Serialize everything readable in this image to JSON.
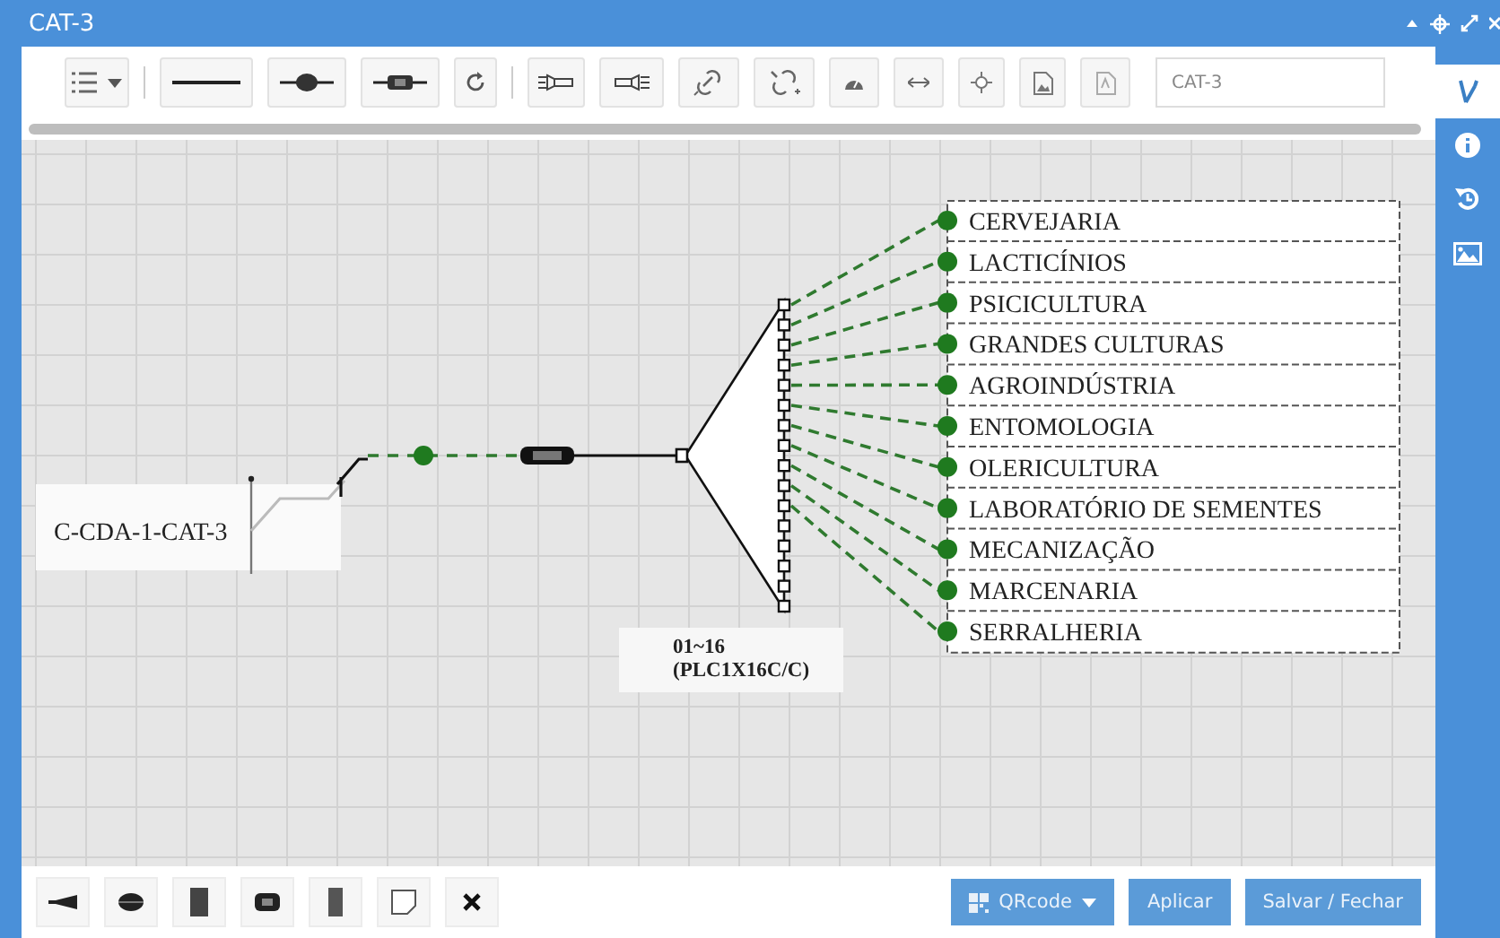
{
  "window": {
    "title": "CAT-3"
  },
  "toolbar": {
    "name_value": "CAT-3"
  },
  "side_tabs": [
    {
      "selected": true
    },
    {
      "selected": false
    },
    {
      "selected": false
    },
    {
      "selected": false
    }
  ],
  "diagram": {
    "source_label": "C-CDA-1-CAT-3",
    "port_label": [
      "01~16",
      "(PLC1X16C/C)"
    ],
    "destinations": [
      {
        "name": "CERVEJARIA"
      },
      {
        "name": "LACTICÍNIOS"
      },
      {
        "name": "PSICICULTURA"
      },
      {
        "name": "GRANDES CULTURAS"
      },
      {
        "name": "AGROINDÚSTRIA"
      },
      {
        "name": "ENTOMOLOGIA"
      },
      {
        "name": "OLERICULTURA"
      },
      {
        "name": "LABORATÓRIO DE SEMENTES"
      },
      {
        "name": "MECANIZAÇÃO"
      },
      {
        "name": "MARCENARIA"
      },
      {
        "name": "SERRALHERIA"
      }
    ]
  },
  "footer": {
    "qrcode": "QRcode",
    "apply": "Aplicar",
    "save": "Salvar / Fechar"
  }
}
